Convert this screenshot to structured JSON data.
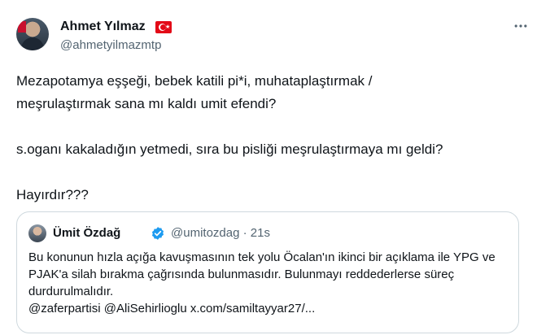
{
  "tweet": {
    "author_name": "Ahmet Yılmaz",
    "author_handle": "@ahmetyilmazmtp",
    "more_icon": "more-horizontal-icon",
    "flag_icon": "turkey-flag-icon",
    "text": "Mezapotamya eşşeği, bebek katili pi*i, muhataplaştırmak /\nmeşrulaştırmak sana mı kaldı umit efendi?\n\ns.oganı kakaladığın yetmedi, sıra bu pisliği meşrulaştırmaya mı geldi?\n\nHayırdır???"
  },
  "quoted_tweet": {
    "author_name": "Ümit Özdağ",
    "verified_icon": "verified-badge-icon",
    "author_handle": "@umitozdag",
    "separator": "·",
    "time": "21s",
    "text": "Bu konunun hızla açığa kavuşmasının tek yolu Öcalan'ın ikinci bir açıklama ile YPG ve PJAK'a silah bırakma çağrısında bulunmasıdır. Bulunmayı reddederlerse süreç durdurulmalıdır.",
    "mentions_line": "@zaferpartisi @AliSehirlioglu x.com/samiltayyar27/..."
  },
  "colors": {
    "primary_text": "#0f1419",
    "secondary_text": "#536471",
    "border": "#cfd9de",
    "verified": "#1d9bf0",
    "flag_red": "#e30a17"
  }
}
